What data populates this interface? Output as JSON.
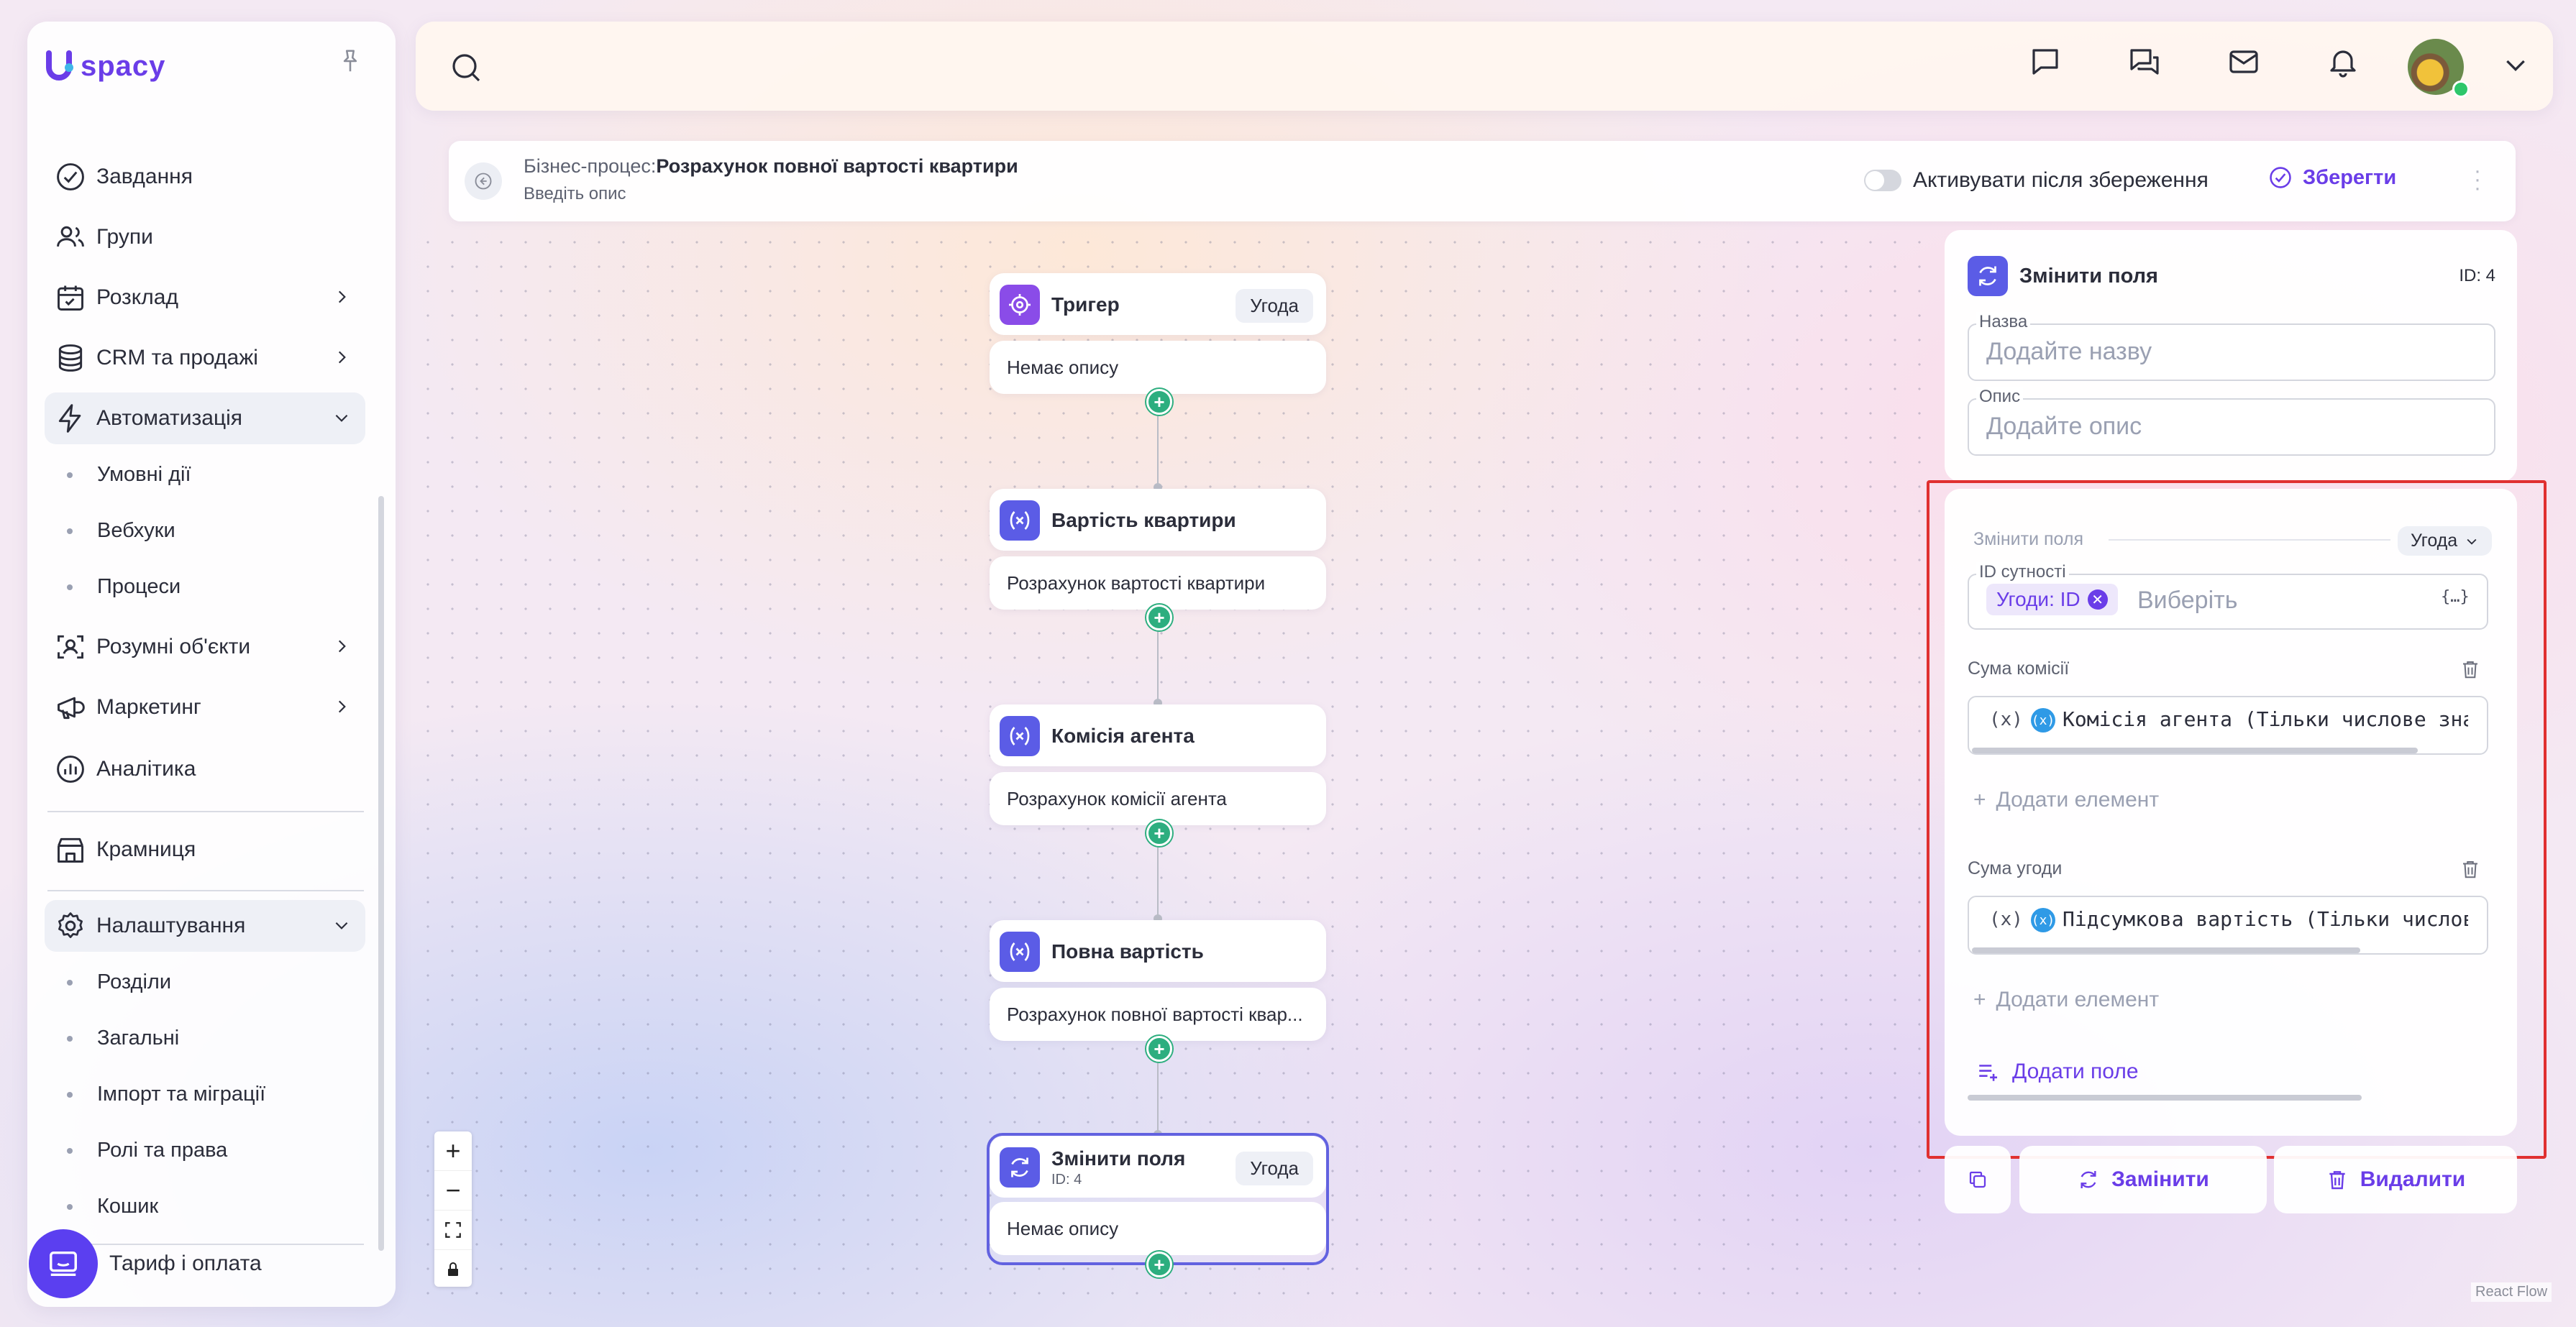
{
  "sidebar": {
    "logo": "spacy",
    "nav": [
      {
        "label": "Завдання"
      },
      {
        "label": "Групи"
      },
      {
        "label": "Розклад"
      },
      {
        "label": "CRM та продажі"
      },
      {
        "label": "Автоматизація"
      },
      {
        "label": "Розумні об'єкти"
      },
      {
        "label": "Маркетинг"
      },
      {
        "label": "Аналітика"
      },
      {
        "label": "Крамниця"
      },
      {
        "label": "Налаштування"
      }
    ],
    "automation_sub": [
      "Умовні дії",
      "Вебхуки",
      "Процеси"
    ],
    "settings_sub": [
      "Розділи",
      "Загальні",
      "Імпорт та міграції",
      "Ролі та права",
      "Кошик"
    ],
    "tariff": "Тариф і оплата"
  },
  "process_bar": {
    "prefix": "Бізнес-процес:",
    "title": "Розрахунок повної вартості квартири",
    "description_placeholder": "Введіть опис",
    "toggle_label": "Активувати після збереження",
    "save_label": "Зберегти"
  },
  "flow": {
    "nodes": [
      {
        "title": "Тригер",
        "badge": "Угода",
        "description": "Немає опису"
      },
      {
        "title": "Вартість квартири",
        "description": "Розрахунок вартості квартири"
      },
      {
        "title": "Комісія агента",
        "description": "Розрахунок комісії агента"
      },
      {
        "title": "Повна вартість",
        "description": "Розрахунок повної вартості квар..."
      },
      {
        "title": "Змінити поля",
        "subtitle": "ID: 4",
        "badge": "Угода",
        "description": "Немає опису"
      }
    ]
  },
  "panel": {
    "title": "Змінити поля",
    "id_label": "ID: 4",
    "name_label": "Назва",
    "name_placeholder": "Додайте назву",
    "desc_label": "Опис",
    "desc_placeholder": "Додайте опис",
    "section_label": "Змінити поля",
    "entity": "Угода",
    "entity_id_label": "ID сутності",
    "entity_chip": "Угоди: ID",
    "entity_placeholder": "Виберіть",
    "fields": [
      {
        "label": "Сума комісії",
        "var_prefix": "(x)",
        "value": "Комісія агента (Тільки числове значення пол",
        "add_label": "Додати елемент"
      },
      {
        "label": "Сума угоди",
        "var_prefix": "(x)",
        "value": "Підсумкова вартість (Тільки числове значенн",
        "add_label": "Додати елемент"
      }
    ],
    "add_field": "Додати поле",
    "replace_label": "Замінити",
    "delete_label": "Видалити"
  },
  "footer": {
    "react_flow": "React Flow"
  },
  "colors": {
    "accent": "#6a3de8",
    "node_icon": "#5b5ce6",
    "connector_dot": "#2dae7f",
    "highlight": "#e03030"
  }
}
